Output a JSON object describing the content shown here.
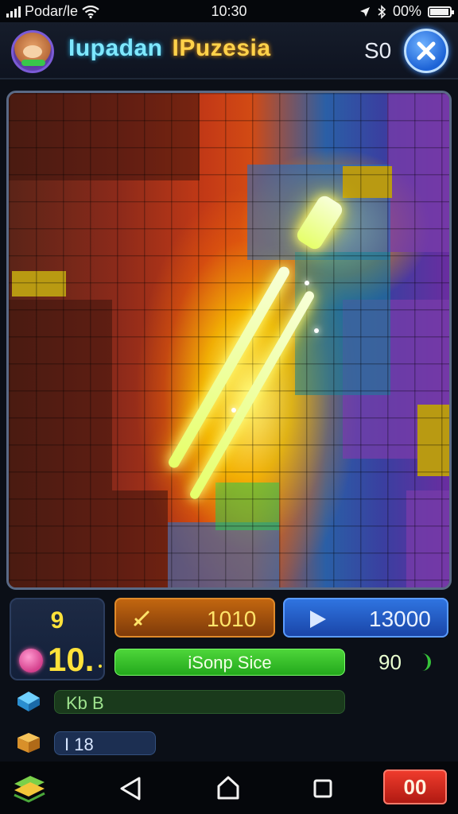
{
  "status_bar": {
    "carrier": "Podar/le",
    "time": "10:30",
    "battery": "00%",
    "battery_level": 0.9,
    "icons": [
      "signal-icon",
      "wifi-icon",
      "location-icon",
      "bluetooth-icon",
      "battery-icon"
    ]
  },
  "header": {
    "title_part1": "Iupadan",
    "title_part2": "IPuzesia",
    "score": "S0",
    "close_icon": "close-icon"
  },
  "panel": {
    "left_box_top": "9",
    "left_box_value": "10.",
    "orange_button_label": "1010",
    "blue_button_label": "13000",
    "green_bar_label": "iSonp Sice",
    "green_value": "90",
    "dark_green_bar_label": "Kb B",
    "navy_bar_label": "I  18"
  },
  "navbar": {
    "red_button_label": "00",
    "icons": [
      "app-icon",
      "back-icon",
      "home-icon",
      "recent-apps-icon"
    ]
  },
  "colors": {
    "accent_blue": "#2f74e0",
    "accent_orange": "#c2660f",
    "accent_green": "#4ed63a",
    "title_cyan": "#7ee8ff",
    "title_gold": "#ffd24a",
    "score_yellow": "#ffe23a",
    "red_button": "#ef3b2c"
  }
}
